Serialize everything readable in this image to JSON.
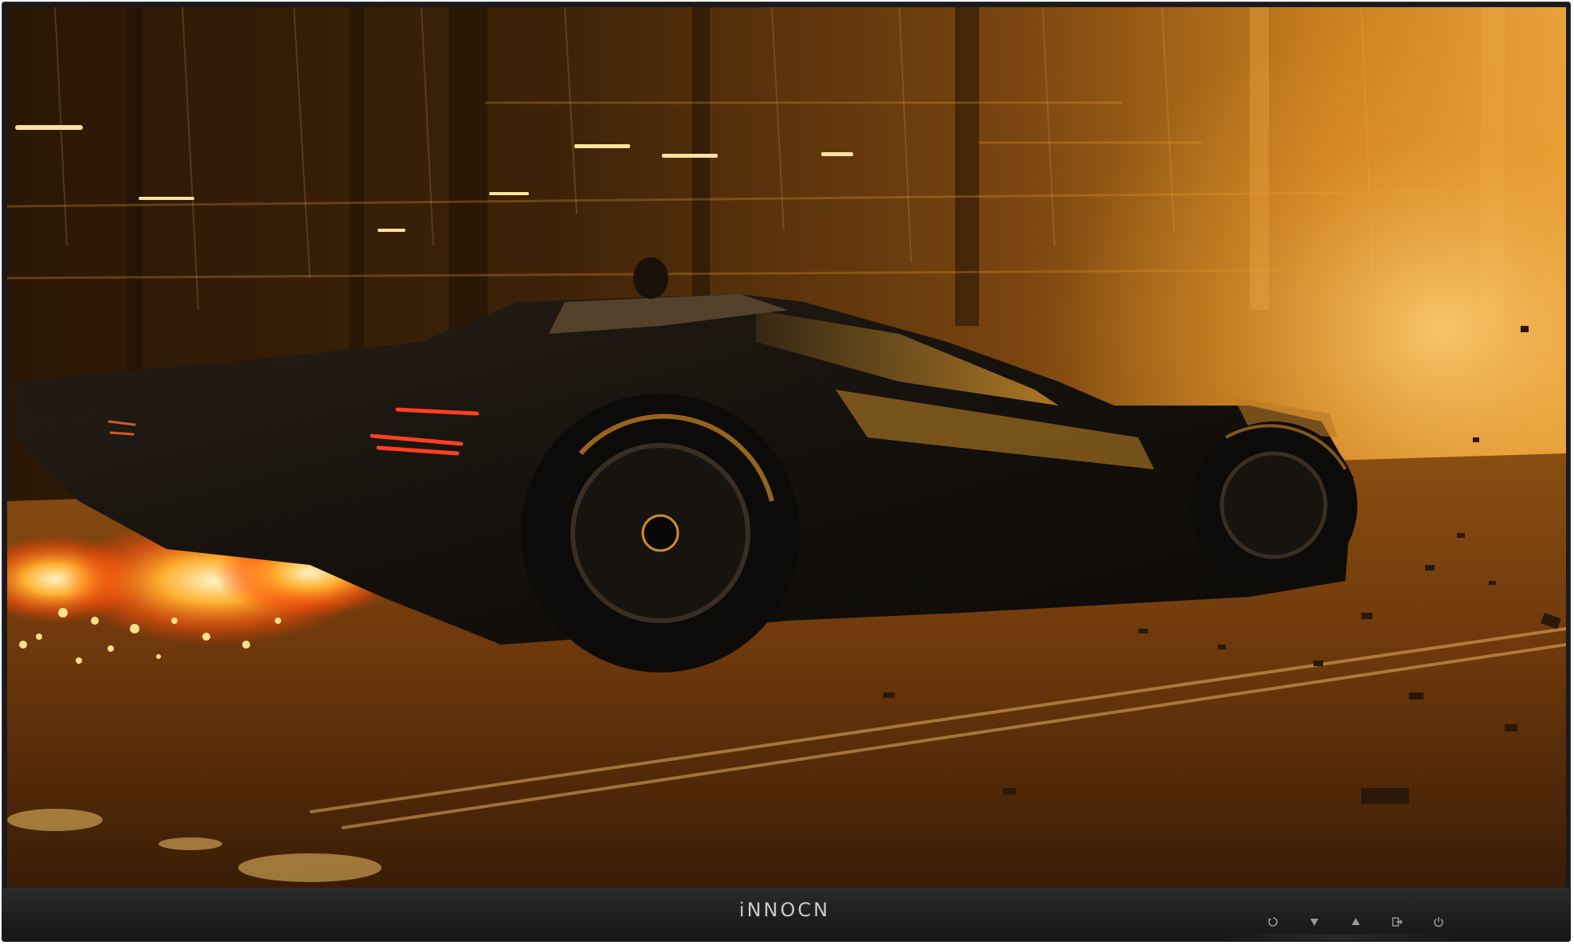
{
  "brand": {
    "logo_text": "iNNOCN"
  },
  "screen": {
    "content": "wallpaper-image",
    "palette": {
      "sky": "#3a1e06",
      "glow": "#f0a020",
      "fire": "#ff6a10",
      "car": "#1b1610",
      "road": "#6b3a0b"
    }
  },
  "controls": [
    {
      "id": "input",
      "icon": "input-source-icon"
    },
    {
      "id": "down",
      "icon": "arrow-down-icon"
    },
    {
      "id": "up",
      "icon": "arrow-up-icon"
    },
    {
      "id": "exit",
      "icon": "exit-icon"
    },
    {
      "id": "power",
      "icon": "power-icon"
    }
  ]
}
